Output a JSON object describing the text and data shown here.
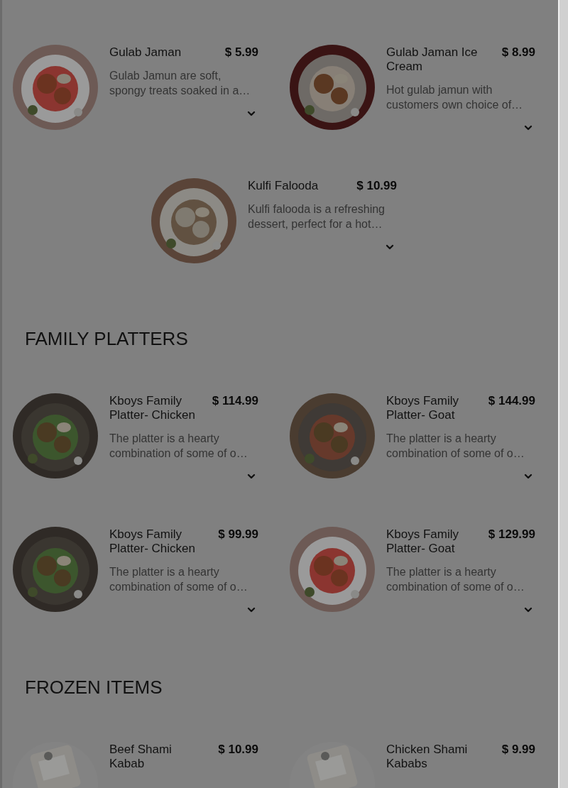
{
  "sections": [
    {
      "items": [
        {
          "title": "Gulab Jaman",
          "price": "$ 5.99",
          "description": "Gulab Jamun are soft, spongy treats soaked in a…"
        },
        {
          "title": "Gulab Jaman Ice Cream",
          "price": "$ 8.99",
          "description": "Hot gulab jamun with customers own choice of…"
        },
        {
          "title": "Kulfi Falooda",
          "price": "$ 10.99",
          "description": "Kulfi falooda is a refreshing dessert, perfect for a hot…"
        }
      ]
    },
    {
      "heading": "FAMILY PLATTERS",
      "items": [
        {
          "title": "Kboys Family Platter- Chicken",
          "price": "$ 114.99",
          "description": "The platter is a hearty combination of some of o…"
        },
        {
          "title": "Kboys Family Platter- Goat",
          "price": "$ 144.99",
          "description": "The platter is a hearty combination of some of o…"
        },
        {
          "title": "Kboys Family Platter- Chicken",
          "price": "$ 99.99",
          "description": "The platter is a hearty combination of some of o…"
        },
        {
          "title": "Kboys Family Platter- Goat",
          "price": "$ 129.99",
          "description": "The platter is a hearty combination of some of o…"
        }
      ]
    },
    {
      "heading": "FROZEN ITEMS",
      "items": [
        {
          "title": "Beef Shami Kabab",
          "price": "$ 10.99"
        },
        {
          "title": "Chicken Shami Kababs",
          "price": "$ 9.99"
        }
      ]
    }
  ]
}
